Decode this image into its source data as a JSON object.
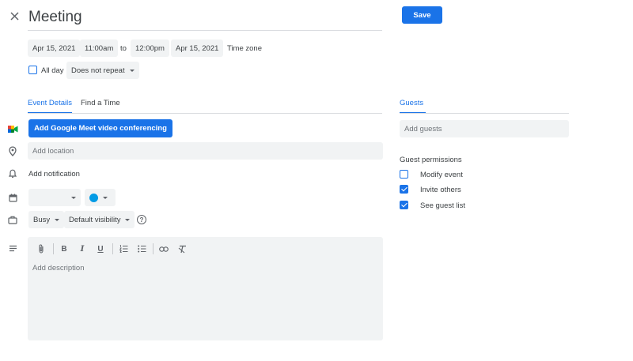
{
  "header": {
    "title": "Meeting",
    "save_label": "Save"
  },
  "datetime": {
    "start_date": "Apr 15, 2021",
    "start_time": "11:00am",
    "to_label": "to",
    "end_time": "12:00pm",
    "end_date": "Apr 15, 2021",
    "timezone_label": "Time zone",
    "allday_label": "All day",
    "repeat_value": "Does not repeat"
  },
  "tabs": {
    "event_details": "Event Details",
    "find_time": "Find a Time",
    "guests": "Guests"
  },
  "details": {
    "meet_button": "Add Google Meet video conferencing",
    "location_placeholder": "Add location",
    "notification_label": "Add notification",
    "calendar_value": "",
    "event_color": "#039be5",
    "busy_value": "Busy",
    "visibility_value": "Default visibility",
    "description_placeholder": "Add description"
  },
  "guests": {
    "add_placeholder": "Add guests",
    "permissions_title": "Guest permissions",
    "permissions": [
      {
        "label": "Modify event",
        "checked": false
      },
      {
        "label": "Invite others",
        "checked": true
      },
      {
        "label": "See guest list",
        "checked": true
      }
    ]
  },
  "colors": {
    "accent": "#1a73e8",
    "field_bg": "#f1f3f4",
    "text": "#3c4043"
  },
  "toolbar_icons": [
    "attach-icon",
    "bold-icon",
    "italic-icon",
    "underline-icon",
    "numbered-list-icon",
    "bulleted-list-icon",
    "link-icon",
    "clear-format-icon"
  ]
}
